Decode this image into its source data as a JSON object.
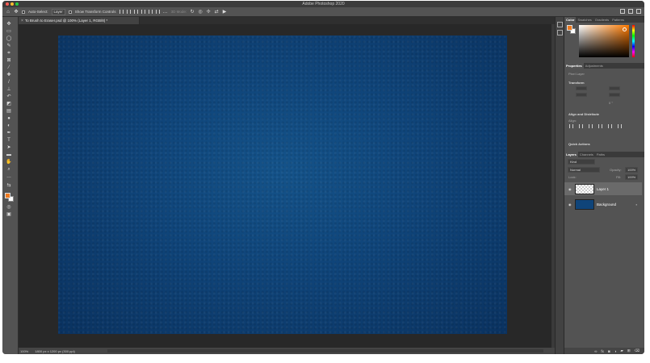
{
  "app": {
    "title": "Adobe Photoshop 2020"
  },
  "options_bar": {
    "auto_select_label": "Auto-Select:",
    "auto_select_value": "Layer",
    "transform_controls_label": "Show Transform Controls",
    "mode_3d_label": "3D Mode:"
  },
  "document": {
    "tab_title": "To Brush to Eraser.psd @ 100% (Layer 1, RGB/8) *"
  },
  "status": {
    "zoom": "100%",
    "doc_size": "1800 px x 1200 px (300 ppi)"
  },
  "colors": {
    "foreground": "#ee7a1f",
    "background": "#ffffff",
    "canvas": "#0f4479"
  },
  "color_panel": {
    "tabs": [
      "Color",
      "Swatches",
      "Gradients",
      "Patterns"
    ]
  },
  "properties_panel": {
    "tabs": [
      "Properties",
      "Adjustments"
    ],
    "pixel_layer": "Pixel Layer",
    "transform_title": "Transform",
    "angle_value": "0 °",
    "align_title": "Align and Distribute",
    "align_label": "Align:",
    "quick_actions_title": "Quick Actions"
  },
  "layers_panel": {
    "tabs": [
      "Layers",
      "Channels",
      "Paths"
    ],
    "kind_label": "Kind",
    "blend_mode": "Normal",
    "opacity_label": "Opacity:",
    "opacity_value": "100%",
    "lock_label": "Lock:",
    "fill_label": "Fill:",
    "fill_value": "100%",
    "layers": [
      {
        "name": "Layer 1",
        "selected": true
      },
      {
        "name": "Background",
        "selected": false,
        "locked": true
      }
    ]
  }
}
